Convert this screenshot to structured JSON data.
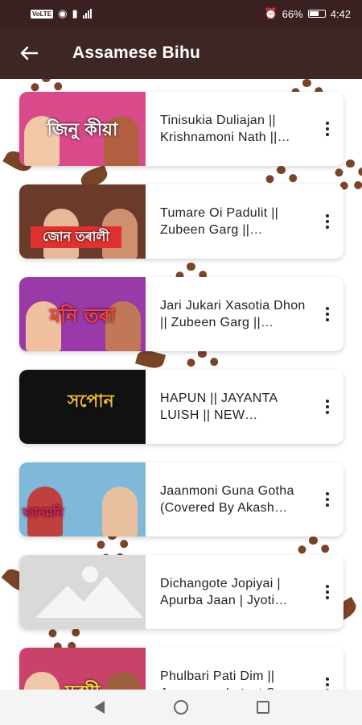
{
  "status_bar": {
    "left_icons": [
      "volte-icon",
      "wifi-icon",
      "notification-icon",
      "signal-icon"
    ],
    "volte_text": "VoLTE",
    "battery_percent": "66%",
    "time": "4:42",
    "battery_level": 0.66
  },
  "app_bar": {
    "title": "Assamese Bihu",
    "back_icon": "arrow-left-icon"
  },
  "videos": [
    {
      "title": "Tinisukia Duliajan || Krishnamoni Nath || Assamese Bihu Song",
      "thumb_text": "জিনু কীয়া",
      "thumb_bg": "#d84a8a"
    },
    {
      "title": "Tumare Oi Padulit || Zubeen Garg || Assamese Song",
      "thumb_text": "জোন তৰালী",
      "thumb_bg": "#6a3a2a"
    },
    {
      "title": "Jari Jukari Xasotia Dhon || Zubeen Garg || Assamese Song",
      "thumb_text": "মনি তৰা",
      "thumb_bg": "#9a3aa8"
    },
    {
      "title": "HAPUN ||  JAYANTA LUISH || NEW ASSAMESE SONG",
      "thumb_text": "সপোন",
      "thumb_bg": "#111111"
    },
    {
      "title": "Jaanmoni Guna Gotha (Covered By Akash Deep)",
      "thumb_text": "জানমনি",
      "thumb_bg": "#7fb8d8"
    },
    {
      "title": "Dichangote Jopiyai | Apurba Jaan | Jyoti Prasad",
      "thumb_text": "",
      "thumb_bg": "#d9d9d9"
    },
    {
      "title": "Phulbari Pati Dim || Assamese Latest Song",
      "thumb_text": "মৰমী",
      "thumb_bg": "#c8426a"
    }
  ],
  "nav_bar": {
    "back_icon": "triangle-back-icon",
    "home_icon": "circle-home-icon",
    "recent_icon": "square-recent-icon"
  }
}
